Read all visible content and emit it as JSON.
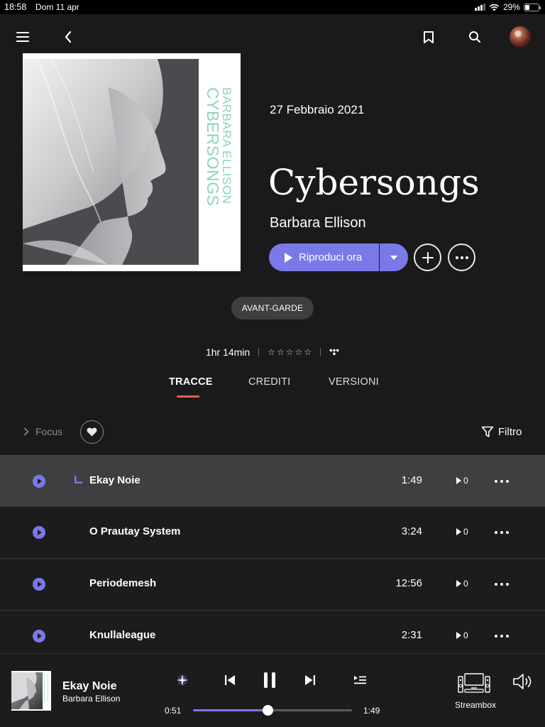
{
  "status_bar": {
    "time": "18:58",
    "date": "Dom 11 apr",
    "battery": "29%"
  },
  "album": {
    "release_date": "27 Febbraio 2021",
    "title": "Cybersongs",
    "artist": "Barbara Ellison",
    "cover_artist_text": "BARBARA ELLISON",
    "cover_title_text": "CYBERSONGS",
    "play_label": "Riproduci ora",
    "genre": "AVANT-GARDE",
    "duration": "1hr 14min",
    "rating_stars": 0
  },
  "tabs": [
    {
      "label": "TRACCE",
      "active": true
    },
    {
      "label": "CREDITI",
      "active": false
    },
    {
      "label": "VERSIONI",
      "active": false
    }
  ],
  "toolbar": {
    "focus_label": "Focus",
    "filter_label": "Filtro"
  },
  "tracks": [
    {
      "name": "Ekay Noie",
      "duration": "1:49",
      "plays": "0",
      "playing": true
    },
    {
      "name": "O Prautay System",
      "duration": "3:24",
      "plays": "0",
      "playing": false
    },
    {
      "name": "Periodemesh",
      "duration": "12:56",
      "plays": "0",
      "playing": false
    },
    {
      "name": "Knullaleague",
      "duration": "2:31",
      "plays": "0",
      "playing": false
    }
  ],
  "player": {
    "title": "Ekay Noie",
    "artist": "Barbara Ellison",
    "elapsed": "0:51",
    "total": "1:49",
    "progress": 0.47,
    "device": "Streambox"
  },
  "colors": {
    "accent": "#7b79e8",
    "tab_underline": "#e45f4f",
    "background": "#1a1a1b",
    "active_row": "#3f3f41",
    "cover_text": "#8fd4b8"
  }
}
